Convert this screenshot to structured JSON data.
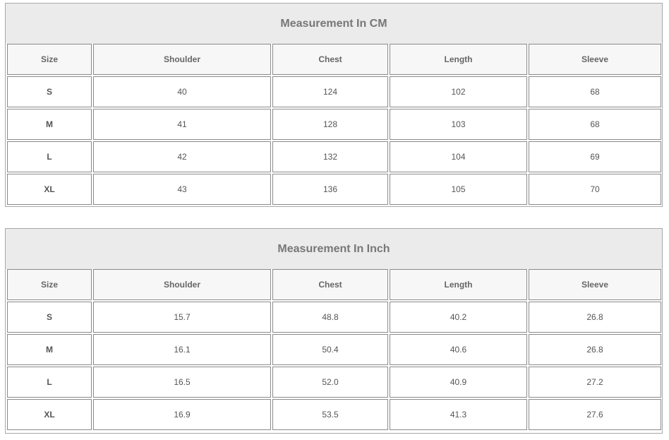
{
  "tables": [
    {
      "title": "Measurement In CM",
      "headers": [
        "Size",
        "Shoulder",
        "Chest",
        "Length",
        "Sleeve"
      ],
      "rows": [
        [
          "S",
          "40",
          "124",
          "102",
          "68"
        ],
        [
          "M",
          "41",
          "128",
          "103",
          "68"
        ],
        [
          "L",
          "42",
          "132",
          "104",
          "69"
        ],
        [
          "XL",
          "43",
          "136",
          "105",
          "70"
        ]
      ]
    },
    {
      "title": "Measurement In Inch",
      "headers": [
        "Size",
        "Shoulder",
        "Chest",
        "Length",
        "Sleeve"
      ],
      "rows": [
        [
          "S",
          "15.7",
          "48.8",
          "40.2",
          "26.8"
        ],
        [
          "M",
          "16.1",
          "50.4",
          "40.6",
          "26.8"
        ],
        [
          "L",
          "16.5",
          "52.0",
          "40.9",
          "27.2"
        ],
        [
          "XL",
          "16.9",
          "53.5",
          "41.3",
          "27.6"
        ]
      ]
    }
  ]
}
